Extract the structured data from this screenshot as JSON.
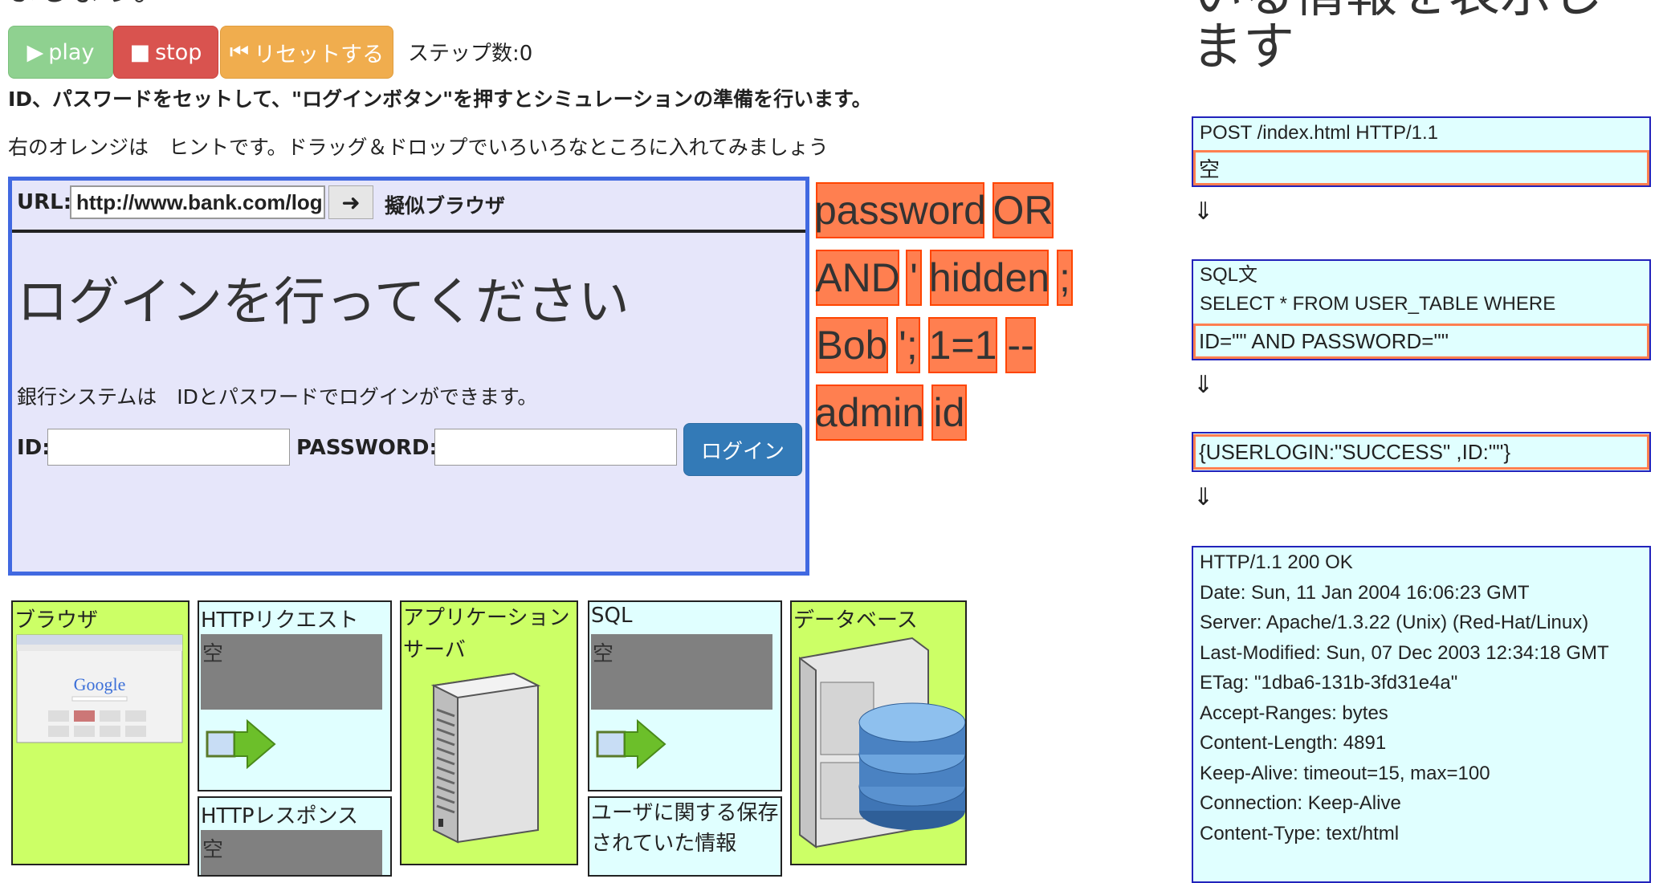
{
  "top": {
    "title_partial": "ましょう。"
  },
  "controls": {
    "play_label": "play",
    "stop_label": "stop",
    "reset_label": "リセットする",
    "steps_label": "ステップ数:0"
  },
  "instructions": {
    "line1": "ID、パスワードをセットして、\"ログインボタン\"を押すとシミュレーションの準備を行います。",
    "line2": "右のオレンジは　ヒントです。ドラッグ＆ドロップでいろいろなところに入れてみましょう"
  },
  "browser": {
    "url_label": "URL:",
    "url_value": "http://www.bank.com/login",
    "pseudo_label": "擬似ブラウザ",
    "heading": "ログインを行ってください",
    "description": "銀行システムは　IDとパスワードでログインができます。",
    "id_label": "ID:",
    "password_label": "PASSWORD:",
    "login_button": "ログイン"
  },
  "hint_tiles": [
    "password",
    "OR",
    "AND",
    "'",
    "hidden",
    ";",
    "Bob",
    "';",
    "1=1",
    "--",
    "admin",
    "id"
  ],
  "flow": {
    "browser_title": "ブラウザ",
    "http_request_title": "HTTPリクエスト",
    "http_request_value": "空",
    "http_response_title": "HTTPレスポンス",
    "http_response_value": "空",
    "app_server_title": "アプリケーションサーバ",
    "sql_title": "SQL",
    "sql_value": "空",
    "user_info_title": "ユーザに関する保存されていた情報",
    "database_title": "データベース",
    "google_logo": "Google"
  },
  "side": {
    "heading_line1": "いる情報を表示し",
    "heading_line2": "ます",
    "post_line": "POST /index.html HTTP/1.1",
    "post_value": "空",
    "arrow": "⇓",
    "sql_label": "SQL文",
    "sql_query": "SELECT * FROM USER_TABLE WHERE",
    "sql_condition": "ID=\"\" AND PASSWORD=\"\"",
    "result": "{USERLOGIN:\"SUCCESS\" ,ID:\"\"}",
    "response_lines": [
      "HTTP/1.1 200 OK",
      "Date: Sun, 11 Jan 2004 16:06:23 GMT",
      "Server: Apache/1.3.22 (Unix) (Red-Hat/Linux)",
      "Last-Modified: Sun, 07 Dec 2003 12:34:18 GMT",
      "ETag: \"1dba6-131b-3fd31e4a\"",
      "Accept-Ranges: bytes",
      "Content-Length: 4891",
      "Keep-Alive: timeout=15, max=100",
      "Connection: Keep-Alive",
      "Content-Type: text/html"
    ]
  },
  "colors": {
    "hint_fill": "#ff7f50",
    "hint_border": "#ff4500",
    "browser_bg": "#e6e6fa",
    "browser_border": "#4169e1",
    "flow_green": "#ccff66",
    "flow_cyan": "#e0ffff"
  }
}
